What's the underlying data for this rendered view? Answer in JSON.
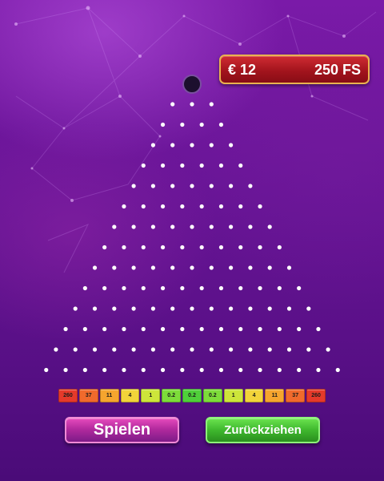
{
  "hud": {
    "balance": "€ 12",
    "free_spins": "250 FS"
  },
  "board": {
    "rows": 14,
    "first_row_pegs": 3
  },
  "multipliers": [
    {
      "label": "260",
      "color": "#e53a2a"
    },
    {
      "label": "37",
      "color": "#f06a2c"
    },
    {
      "label": "11",
      "color": "#f5a52e"
    },
    {
      "label": "4",
      "color": "#f2d43a"
    },
    {
      "label": "1",
      "color": "#cde53a"
    },
    {
      "label": "0.2",
      "color": "#7ddc3a"
    },
    {
      "label": "0.2",
      "color": "#4fcf3a"
    },
    {
      "label": "0.2",
      "color": "#7ddc3a"
    },
    {
      "label": "1",
      "color": "#cde53a"
    },
    {
      "label": "4",
      "color": "#f2d43a"
    },
    {
      "label": "11",
      "color": "#f5a52e"
    },
    {
      "label": "37",
      "color": "#f06a2c"
    },
    {
      "label": "260",
      "color": "#e53a2a"
    }
  ],
  "buttons": {
    "play": "Spielen",
    "withdraw": "Zurückziehen"
  },
  "colors": {
    "peg": "#ffffff",
    "ball": "#1c0f2e",
    "panel_border": "#e9b24f"
  }
}
